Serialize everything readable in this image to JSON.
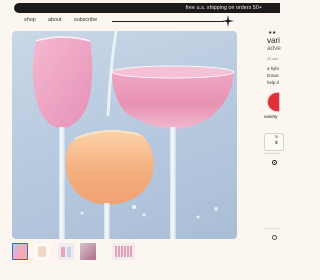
{
  "promo": {
    "text": "free u.s. shipping on orders 50+"
  },
  "nav": {
    "links": [
      {
        "label": "shop"
      },
      {
        "label": "about"
      },
      {
        "label": "subscribe"
      }
    ]
  },
  "gallery": {
    "thumbnail_count": 5,
    "active_thumbnail": 1
  },
  "product": {
    "stars": "★★",
    "title_line1": "vari",
    "title_line2": "adve",
    "review_count": "20 son",
    "desc_lines": [
      "a hybr",
      "brows",
      "help d"
    ],
    "variety_label": "variety",
    "option_label": "te",
    "option_price": "$"
  },
  "colors": {
    "accent_blue": "#2c6fd6",
    "promo_bg": "#1b1b1b",
    "page_bg": "#fbf6ef",
    "variety_red": "#e0303a"
  }
}
